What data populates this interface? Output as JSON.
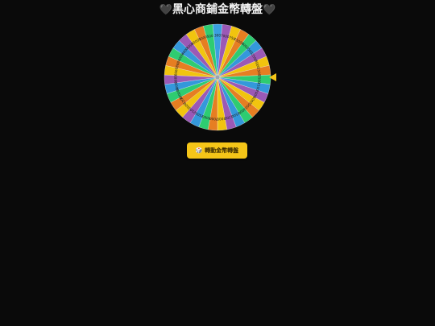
{
  "title": {
    "left_icon": "black-heart-icon",
    "right_icon": "black-heart-icon",
    "heart_glyph": "🖤",
    "text": "黑心商鋪金幣轉盤"
  },
  "wheel": {
    "segments": [
      {
        "label": "300",
        "color": "#3aa0e0"
      },
      {
        "label": "7000",
        "color": "#9b59b6"
      },
      {
        "label": "750",
        "color": "#f1c40f"
      },
      {
        "label": "15000",
        "color": "#e67e22"
      },
      {
        "label": "9000",
        "color": "#2ecc71"
      },
      {
        "label": "500",
        "color": "#3498db"
      },
      {
        "label": "2500",
        "color": "#9b59b6"
      },
      {
        "label": "5000",
        "color": "#f1c40f"
      },
      {
        "label": "1500",
        "color": "#e67e22"
      },
      {
        "label": "2500",
        "color": "#2ecc71"
      },
      {
        "label": "1500",
        "color": "#3498db"
      },
      {
        "label": "7000",
        "color": "#9b59b6"
      },
      {
        "label": "5000",
        "color": "#f1c40f"
      },
      {
        "label": "500",
        "color": "#e67e22"
      },
      {
        "label": "3000",
        "color": "#2ecc71"
      },
      {
        "label": "1500",
        "color": "#3498db"
      },
      {
        "label": "1200",
        "color": "#9b59b6"
      },
      {
        "label": "2000",
        "color": "#f1c40f"
      },
      {
        "label": "7000",
        "color": "#e67e22"
      },
      {
        "label": "6000",
        "color": "#2ecc71"
      },
      {
        "label": "2500",
        "color": "#3498db"
      },
      {
        "label": "250",
        "color": "#9b59b6"
      },
      {
        "label": "3500",
        "color": "#f1c40f"
      },
      {
        "label": "1200",
        "color": "#e67e22"
      },
      {
        "label": "100000",
        "color": "#2ecc71"
      },
      {
        "label": "8000",
        "color": "#3498db"
      },
      {
        "label": "8881",
        "color": "#9b59b6"
      },
      {
        "label": "6666",
        "color": "#f1c40f"
      },
      {
        "label": "888",
        "color": "#e67e22"
      },
      {
        "label": "4000",
        "color": "#2ecc71"
      },
      {
        "label": "4000",
        "color": "#3498db"
      },
      {
        "label": "3000",
        "color": "#9b59b6"
      },
      {
        "label": "10000",
        "color": "#f1c40f"
      },
      {
        "label": "1000",
        "color": "#e67e22"
      },
      {
        "label": "500",
        "color": "#2ecc71"
      }
    ],
    "hub_color": "#9aa3b0"
  },
  "pointer": {
    "color": "#f5c518"
  },
  "spin_button": {
    "icon": "dice-icon",
    "icon_glyph": "🎲",
    "label": "轉動金幣轉盤",
    "color": "#f5c518"
  }
}
